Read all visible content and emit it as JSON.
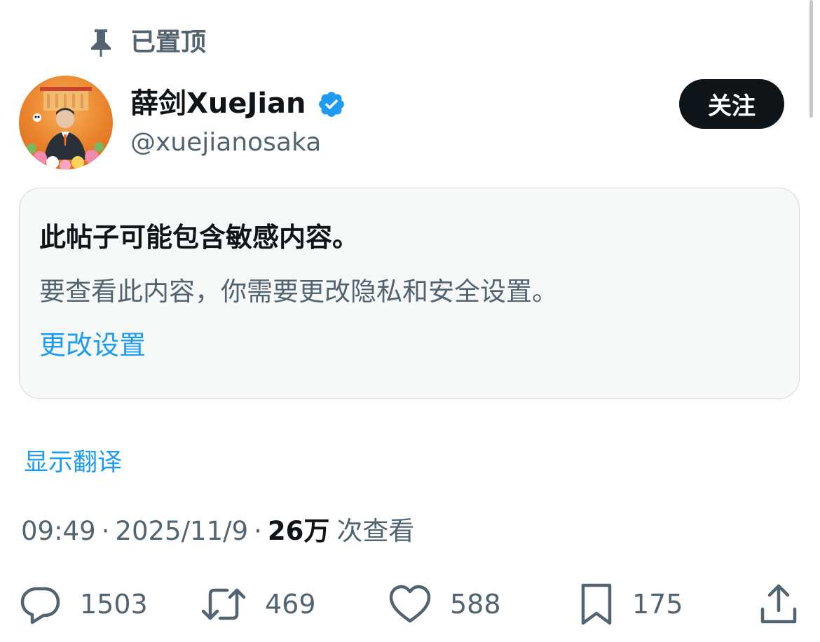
{
  "pinned": {
    "label": "已置顶",
    "icon": "pin-icon"
  },
  "author": {
    "display_name": "薛剑XueJian",
    "handle": "@xuejianosaka",
    "verified_icon": "verified-badge-icon",
    "verified_color": "#1d9bf0"
  },
  "follow_button": {
    "label": "关注"
  },
  "notice": {
    "title": "此帖子可能包含敏感内容。",
    "body": "要查看此内容，你需要更改隐私和安全设置。",
    "link": "更改设置"
  },
  "translate": {
    "label": "显示翻译"
  },
  "meta": {
    "time": "09:49",
    "date": "2025/11/9",
    "separator": "·",
    "views_count": "26万",
    "views_label": "次查看"
  },
  "actions": {
    "reply": {
      "icon": "reply-icon",
      "count": "1503"
    },
    "retweet": {
      "icon": "retweet-icon",
      "count": "469"
    },
    "like": {
      "icon": "heart-icon",
      "count": "588"
    },
    "bookmark": {
      "icon": "bookmark-icon",
      "count": "175"
    },
    "share": {
      "icon": "share-icon"
    }
  },
  "colors": {
    "accent": "#1d9bf0",
    "text_primary": "#0f1419",
    "text_secondary": "#536471",
    "notice_bg": "#f7f9f9",
    "notice_border": "#cfd9de"
  }
}
